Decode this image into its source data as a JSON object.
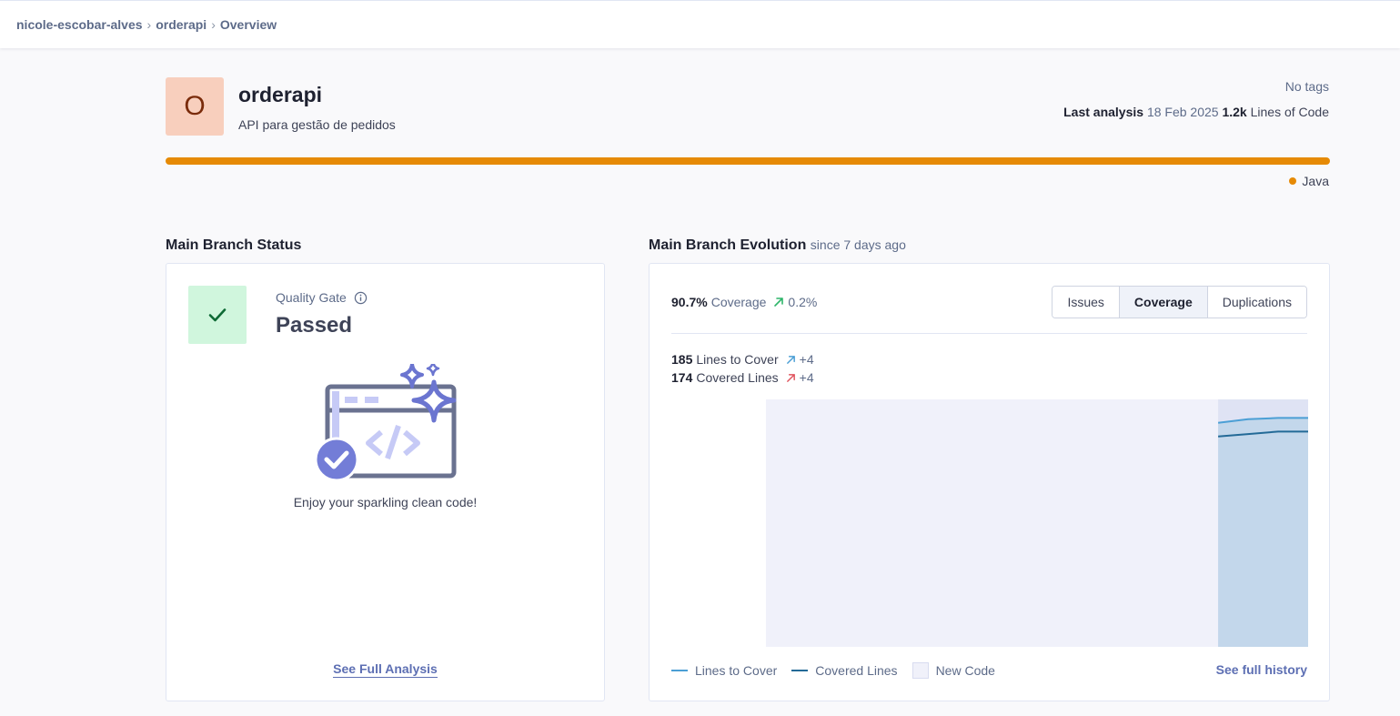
{
  "breadcrumb": {
    "items": [
      "nicole-escobar-alves",
      "orderapi",
      "Overview"
    ],
    "separator": "›"
  },
  "project": {
    "avatar_letter": "O",
    "name": "orderapi",
    "description": "API para gestão de pedidos",
    "tags": "No tags",
    "last_analysis_label": "Last analysis",
    "last_analysis_date": "18 Feb 2025",
    "loc_value": "1.2k",
    "loc_label": "Lines of Code",
    "language": "Java",
    "language_color": "#e68a05"
  },
  "status": {
    "section_title": "Main Branch Status",
    "quality_gate_label": "Quality Gate",
    "quality_gate_value": "Passed",
    "message": "Enjoy your sparkling clean code!",
    "see_full_analysis": "See Full Analysis"
  },
  "evolution": {
    "section_title": "Main Branch Evolution",
    "since": "since 7 days ago",
    "coverage_value": "90.7%",
    "coverage_label": "Coverage",
    "coverage_delta": "0.2%",
    "tabs": [
      {
        "label": "Issues",
        "active": false
      },
      {
        "label": "Coverage",
        "active": true
      },
      {
        "label": "Duplications",
        "active": false
      }
    ],
    "lines_to_cover_value": "185",
    "lines_to_cover_label": "Lines to Cover",
    "lines_to_cover_delta": "+4",
    "covered_lines_value": "174",
    "covered_lines_label": "Covered Lines",
    "covered_lines_delta": "+4",
    "legend": {
      "lines_to_cover": "Lines to Cover",
      "covered_lines": "Covered Lines",
      "new_code": "New Code"
    },
    "see_full_history": "See full history"
  },
  "chart_data": {
    "type": "area",
    "new_code_start_fraction": 0.834,
    "series": [
      {
        "name": "Lines to Cover",
        "color": "#4b9fd5",
        "values": [
          181,
          184,
          185,
          185
        ]
      },
      {
        "name": "Covered Lines",
        "color": "#236a97",
        "values": [
          170,
          172,
          174,
          174
        ]
      }
    ],
    "ylim": [
      0,
      200
    ]
  }
}
